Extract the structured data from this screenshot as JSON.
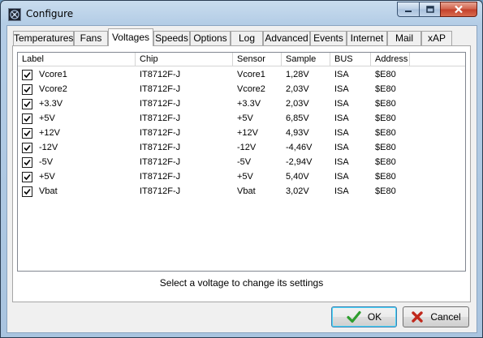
{
  "window": {
    "title": "Configure",
    "icon": "app-icon"
  },
  "tabs": [
    {
      "label": "Temperatures",
      "active": false
    },
    {
      "label": "Fans",
      "active": false
    },
    {
      "label": "Voltages",
      "active": true
    },
    {
      "label": "Speeds",
      "active": false
    },
    {
      "label": "Options",
      "active": false
    },
    {
      "label": "Log",
      "active": false
    },
    {
      "label": "Advanced",
      "active": false
    },
    {
      "label": "Events",
      "active": false
    },
    {
      "label": "Internet",
      "active": false
    },
    {
      "label": "Mail",
      "active": false
    },
    {
      "label": "xAP",
      "active": false
    }
  ],
  "table": {
    "columns": [
      "Label",
      "Chip",
      "Sensor",
      "Sample",
      "BUS",
      "Address"
    ],
    "rows": [
      {
        "checked": true,
        "label": "Vcore1",
        "chip": "IT8712F-J",
        "sensor": "Vcore1",
        "sample": "1,28V",
        "bus": "ISA",
        "address": "$E80"
      },
      {
        "checked": true,
        "label": "Vcore2",
        "chip": "IT8712F-J",
        "sensor": "Vcore2",
        "sample": "2,03V",
        "bus": "ISA",
        "address": "$E80"
      },
      {
        "checked": true,
        "label": "+3.3V",
        "chip": "IT8712F-J",
        "sensor": "+3.3V",
        "sample": "2,03V",
        "bus": "ISA",
        "address": "$E80"
      },
      {
        "checked": true,
        "label": "+5V",
        "chip": "IT8712F-J",
        "sensor": "+5V",
        "sample": "6,85V",
        "bus": "ISA",
        "address": "$E80"
      },
      {
        "checked": true,
        "label": "+12V",
        "chip": "IT8712F-J",
        "sensor": "+12V",
        "sample": "4,93V",
        "bus": "ISA",
        "address": "$E80"
      },
      {
        "checked": true,
        "label": "-12V",
        "chip": "IT8712F-J",
        "sensor": "-12V",
        "sample": "-4,46V",
        "bus": "ISA",
        "address": "$E80"
      },
      {
        "checked": true,
        "label": "-5V",
        "chip": "IT8712F-J",
        "sensor": "-5V",
        "sample": "-2,94V",
        "bus": "ISA",
        "address": "$E80"
      },
      {
        "checked": true,
        "label": "+5V",
        "chip": "IT8712F-J",
        "sensor": "+5V",
        "sample": "5,40V",
        "bus": "ISA",
        "address": "$E80"
      },
      {
        "checked": true,
        "label": "Vbat",
        "chip": "IT8712F-J",
        "sensor": "Vbat",
        "sample": "3,02V",
        "bus": "ISA",
        "address": "$E80"
      }
    ]
  },
  "hint": "Select a voltage to change its settings",
  "buttons": {
    "ok": {
      "label": "OK",
      "icon": "checkmark-icon"
    },
    "cancel": {
      "label": "Cancel",
      "icon": "x-icon"
    }
  },
  "colors": {
    "ok_icon": "#2e9e2e",
    "cancel_icon": "#c0281c",
    "window_frame": "#b4cde6"
  }
}
